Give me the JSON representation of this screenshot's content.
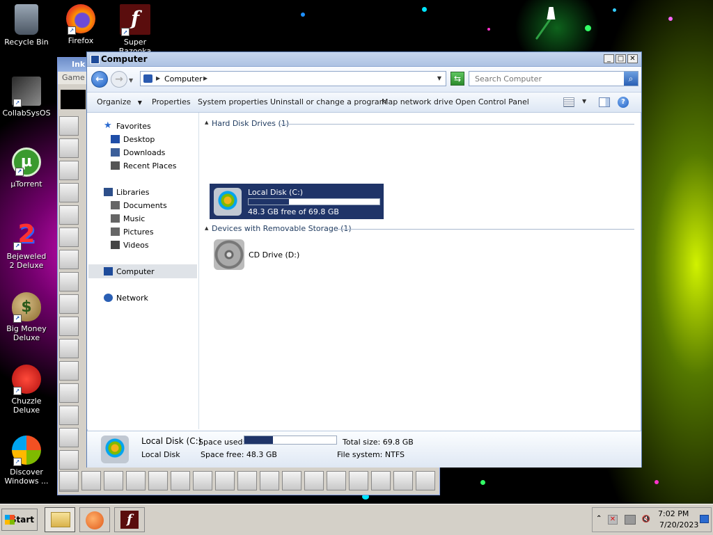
{
  "desktop": {
    "icons": [
      {
        "label": "Recycle Bin"
      },
      {
        "label": "Firefox"
      },
      {
        "label": "Super Bazooka"
      },
      {
        "label": "CollabSysOS"
      },
      {
        "label": "µTorrent"
      },
      {
        "label": "Bejeweled 2 Deluxe"
      },
      {
        "label": "Big Money Deluxe"
      },
      {
        "label": "Chuzzle Deluxe"
      },
      {
        "label": "Discover Windows ..."
      }
    ]
  },
  "background_window": {
    "title": "Ink",
    "menu_item": "Game"
  },
  "explorer": {
    "title": "Computer",
    "address_path": "Computer",
    "search_placeholder": "Search Computer",
    "toolbar": {
      "organize": "Organize",
      "properties": "Properties",
      "system_properties": "System properties",
      "uninstall": "Uninstall or change a program",
      "map_drive": "Map network drive",
      "control_panel": "Open Control Panel"
    },
    "nav": {
      "favorites": "Favorites",
      "desktop": "Desktop",
      "downloads": "Downloads",
      "recent_places": "Recent Places",
      "libraries": "Libraries",
      "documents": "Documents",
      "music": "Music",
      "pictures": "Pictures",
      "videos": "Videos",
      "computer": "Computer",
      "network": "Network"
    },
    "groups": {
      "hdd_header": "Hard Disk Drives (1)",
      "removable_header": "Devices with Removable Storage (1)"
    },
    "drive_c": {
      "name": "Local Disk (C:)",
      "free_text": "48.3 GB free of 69.8 GB",
      "used_fraction": 0.31
    },
    "drive_d": {
      "name": "CD Drive (D:)"
    },
    "details": {
      "name": "Local Disk",
      "drive_letter": "(C:)",
      "type": "Local Disk",
      "space_used_label": "Space used:",
      "space_free_label": "Space free:",
      "space_free_value": "48.3 GB",
      "total_size_label": "Total size:",
      "total_size_value": "69.8 GB",
      "file_system_label": "File system:",
      "file_system_value": "NTFS"
    }
  },
  "taskbar": {
    "start_label": "Start",
    "time": "7:02 PM",
    "date": "7/20/2023"
  },
  "colors": {
    "selection": "#1f3468",
    "title_bar": "#b3c7e6",
    "taskbar": "#d4d0c8"
  }
}
